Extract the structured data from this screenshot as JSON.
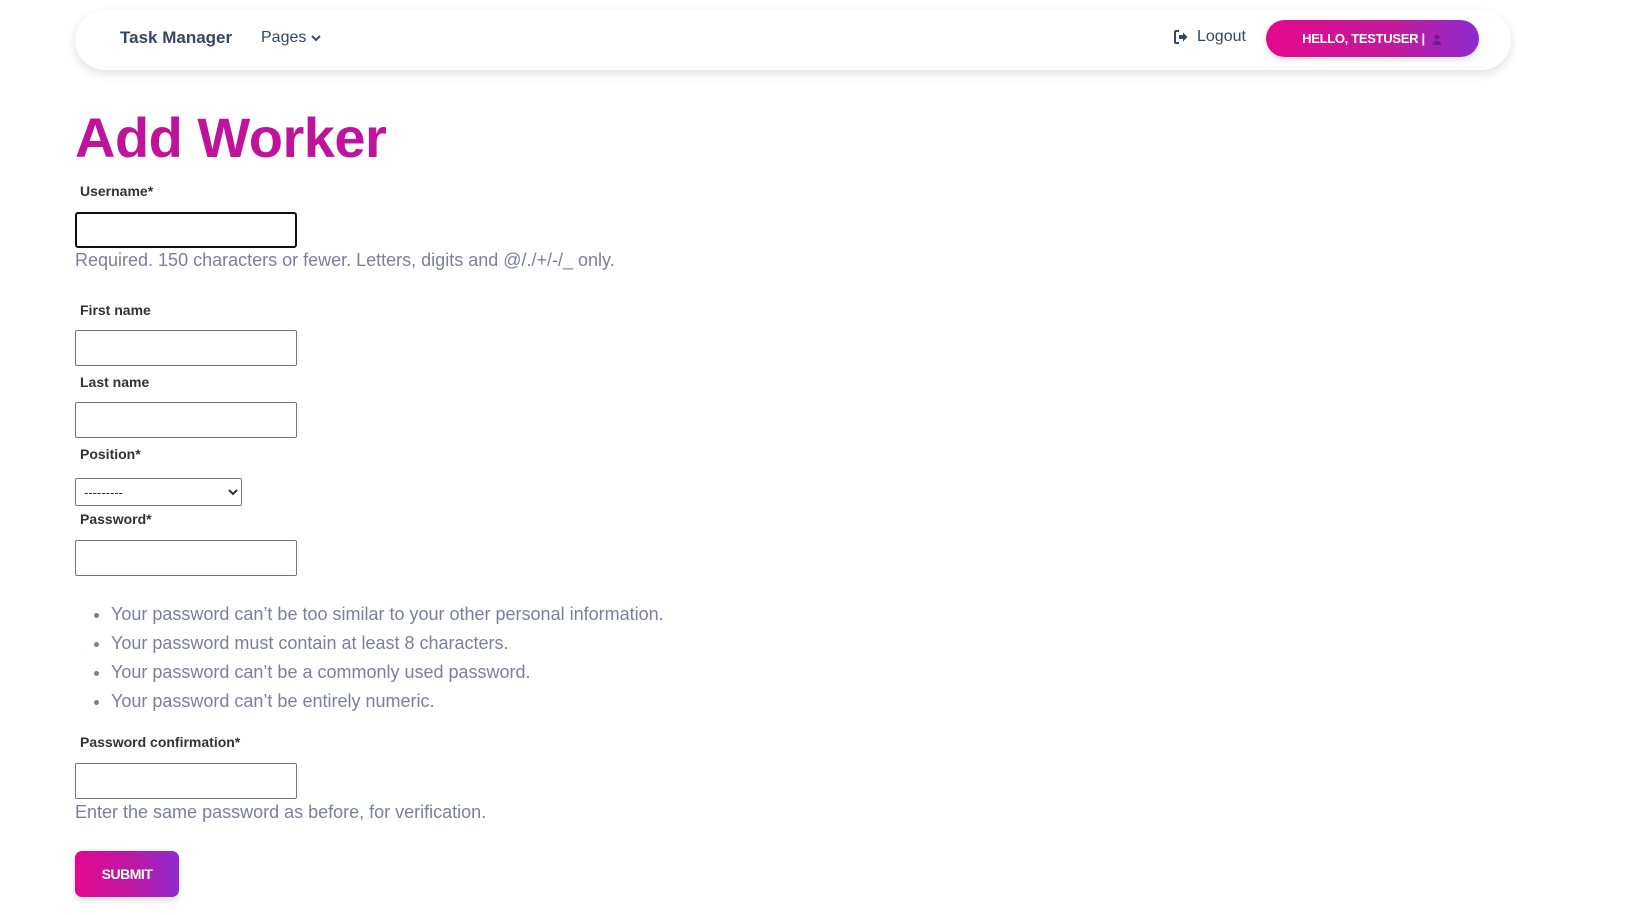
{
  "nav": {
    "brand": "Task Manager",
    "pages_label": "Pages",
    "logout_label": "Logout",
    "hello_label": "HELLO, TESTUSER |"
  },
  "page": {
    "title": "Add Worker"
  },
  "form": {
    "username_label": "Username*",
    "username_value": "",
    "username_help": "Required. 150 characters or fewer. Letters, digits and @/./+/-/_ only.",
    "first_name_label": "First name",
    "first_name_value": "",
    "last_name_label": "Last name",
    "last_name_value": "",
    "position_label": "Position*",
    "position_selected": "---------",
    "password_label": "Password*",
    "password_value": "",
    "password_rules": [
      "Your password can’t be too similar to your other personal information.",
      "Your password must contain at least 8 characters.",
      "Your password can’t be a commonly used password.",
      "Your password can’t be entirely numeric."
    ],
    "password_confirm_label": "Password confirmation*",
    "password_confirm_value": "",
    "password_confirm_help": "Enter the same password as before, for verification.",
    "submit_label": "SUBMIT"
  },
  "colors": {
    "accent": "#c0139c",
    "gradient_start": "#e6078e",
    "gradient_end": "#8e2bd0",
    "help_text": "#7b809a"
  }
}
